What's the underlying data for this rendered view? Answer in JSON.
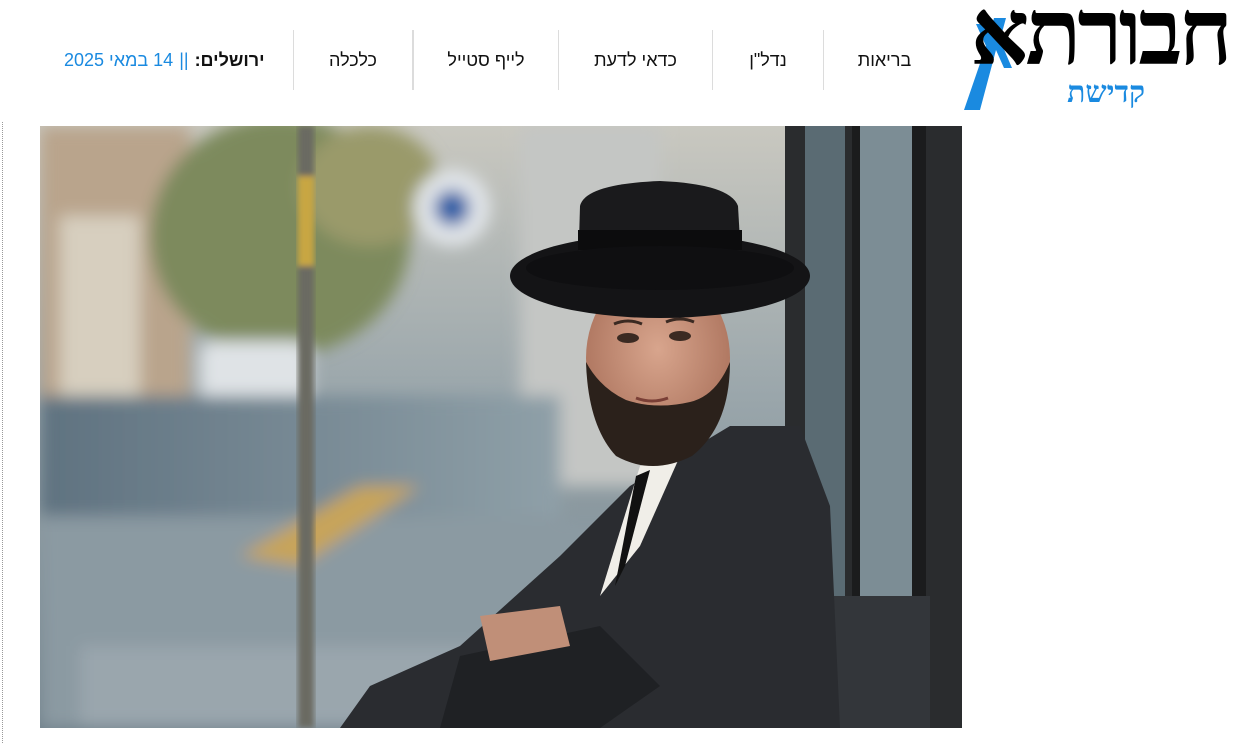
{
  "site": {
    "logo_title": "חבורתא",
    "logo_subtitle": "קדישת"
  },
  "nav": {
    "items": [
      {
        "label": "כלכלה"
      },
      {
        "label": "לייף סטייל"
      },
      {
        "label": "כדאי לדעת"
      },
      {
        "label": "נדל\"ן"
      },
      {
        "label": "בריאות"
      }
    ]
  },
  "dateline": {
    "city": "ירושלים:",
    "separator": "||",
    "date": "14 במאי 2025"
  },
  "hero": {
    "alt": ""
  },
  "colors": {
    "accent": "#1a8ae0",
    "text": "#111111",
    "divider": "#dcdcdc"
  }
}
